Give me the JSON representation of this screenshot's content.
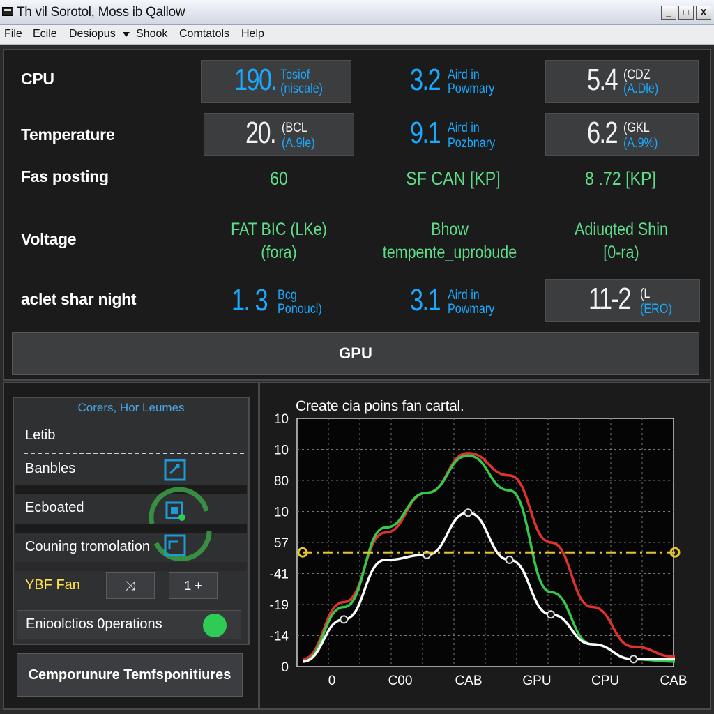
{
  "window": {
    "title": "Th vil Sorotol, Moss ib Qallow",
    "min": "_",
    "max": "□",
    "close": "X"
  },
  "menu": {
    "items": [
      "File",
      "Ecile",
      "Desiopus",
      "Shook",
      "Comtatols",
      "Help"
    ]
  },
  "stats": {
    "rows": [
      {
        "label": "CPU"
      },
      {
        "label": "Temperature"
      },
      {
        "label": "Fas posting"
      },
      {
        "label": "Voltage"
      },
      {
        "label": "aclet shar night"
      }
    ],
    "r0c0": {
      "big": "190.",
      "line1": "Tosiof",
      "line2": "(niscale)"
    },
    "r0c1": {
      "big": "3.2",
      "line1": "Aird in",
      "line2": "Powmary"
    },
    "r0c2": {
      "big": "5.4",
      "line1": "(CDZ",
      "line2": "(A.Dle)"
    },
    "r1c0": {
      "big": "20.",
      "line1": "(BCL",
      "line2": "(A.9le)"
    },
    "r1c1": {
      "big": "9.1",
      "line1": "Aird in",
      "line2": "Pozbnary"
    },
    "r1c2": {
      "big": "6.2",
      "line1": "(GKL",
      "line2": "(A.9%)"
    },
    "r2c0": "60",
    "r2c1": "SF  CAN [KP]",
    "r2c2": "8 .72 [KP]",
    "r3c0": {
      "line1": "FAT BIC (LKe)",
      "line2": "(fora)"
    },
    "r3c1": {
      "line1": "Bhow",
      "line2": "tempente_uprobude"
    },
    "r3c2": {
      "line1": "Adiuqted Shin",
      "line2": "[0-ra)"
    },
    "r4c0": {
      "big": "1. 3",
      "line1": "Bcg",
      "line2": "Ponoucl)"
    },
    "r4c1": {
      "big": "3.1",
      "line1": "Aird in",
      "line2": "Powmary"
    },
    "r4c2": {
      "big": "11-2",
      "line1": "(L",
      "line2": "(ERO)"
    },
    "gpu_label": "GPU"
  },
  "panel": {
    "title": "Corers, Hor Leumes",
    "items": [
      "Letib",
      "Banbles",
      "Ecboated",
      "Couning tromolation"
    ],
    "fan_label": "YBF Fan",
    "btn1": "⤨",
    "btn2": "1 +",
    "op_label": "Enioolctios 0perations",
    "bottom_button": "Cemporunure Temfsponitiures"
  },
  "accent": {
    "green": "#5fdc88",
    "blue": "#1aa9ff",
    "yellow": "#e5c62a",
    "red": "#e0332e"
  },
  "chart_data": {
    "type": "line",
    "title": "Create cia poins fan cartal.",
    "x_ticks": [
      "0",
      "C00",
      "CAB",
      "GPU",
      "CPU",
      "CAB"
    ],
    "y_ticks": [
      "10",
      "10",
      "80",
      "10",
      "57",
      "-41",
      "-19",
      "-14",
      "0"
    ],
    "grid": true,
    "series": [
      {
        "color": "#e0332e",
        "values": [
          0.3,
          2.6,
          5.4,
          7.0,
          8.6,
          7.7,
          5.0,
          2.4,
          0.8,
          0.4
        ]
      },
      {
        "color": "#35c94a",
        "values": [
          0.2,
          2.4,
          5.6,
          7.0,
          8.5,
          7.1,
          3.0,
          0.9,
          0.3,
          0.2
        ]
      },
      {
        "color": "#ffffff",
        "values": [
          0.2,
          1.9,
          4.3,
          4.5,
          6.2,
          4.3,
          2.1,
          0.9,
          0.3,
          0.3
        ]
      },
      {
        "color": "#e5c62a",
        "values": [
          4.6,
          4.6,
          4.6,
          4.6,
          4.6,
          4.6,
          4.6,
          4.6,
          4.6,
          4.6
        ]
      }
    ]
  }
}
